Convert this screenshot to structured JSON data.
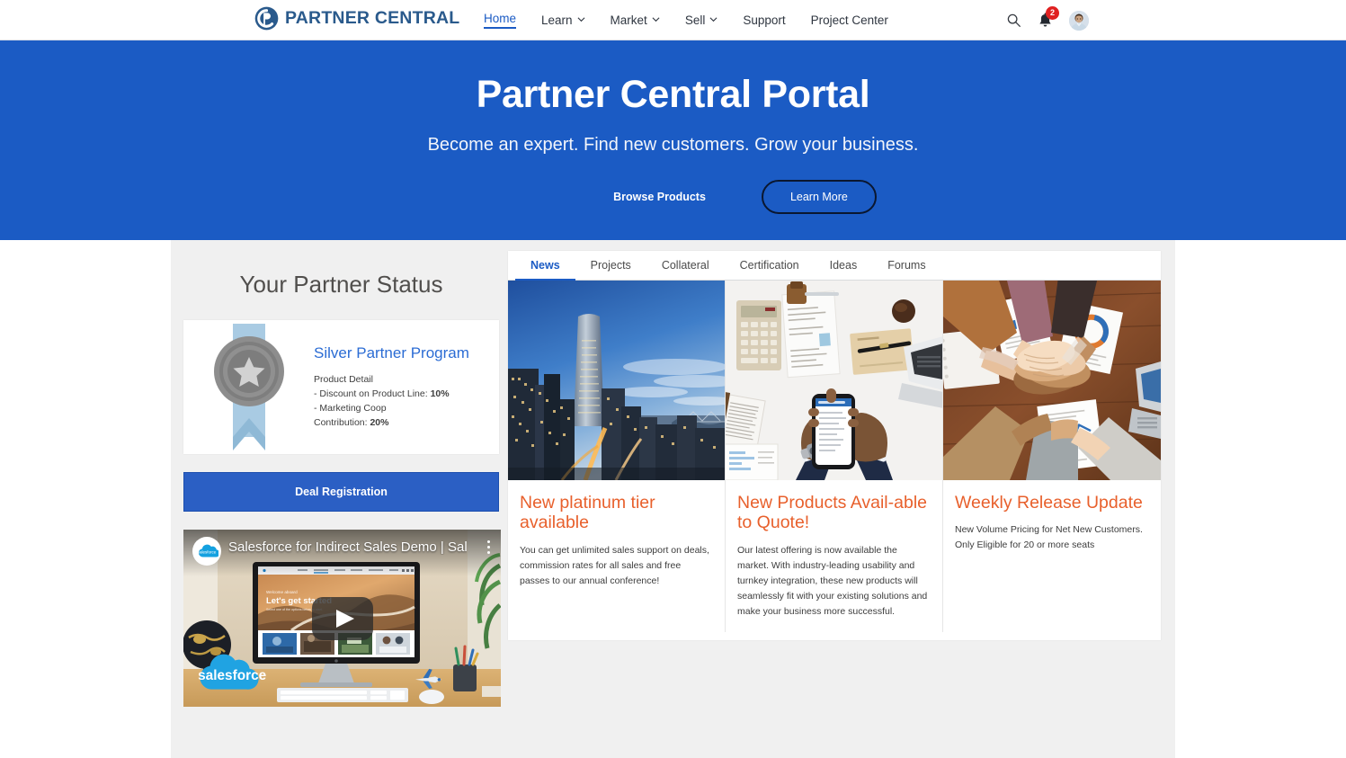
{
  "brand": {
    "name": "PARTNER CENTRAL",
    "logo_icon": "pc-monogram-icon",
    "logo_color": "#2a5a8c"
  },
  "nav": {
    "items": [
      {
        "label": "Home",
        "active": true,
        "has_caret": false
      },
      {
        "label": "Learn",
        "active": false,
        "has_caret": true
      },
      {
        "label": "Market",
        "active": false,
        "has_caret": true
      },
      {
        "label": "Sell",
        "active": false,
        "has_caret": true
      },
      {
        "label": "Support",
        "active": false,
        "has_caret": false
      },
      {
        "label": "Project Center",
        "active": false,
        "has_caret": false
      }
    ],
    "search_icon": "search-icon",
    "notifications_icon": "bell-icon",
    "notifications_count": "2",
    "avatar_icon": "user-avatar"
  },
  "hero": {
    "title": "Partner Central Portal",
    "subtitle": "Become an expert. Find new customers. Grow your business.",
    "browse_label": "Browse Products",
    "learn_more_label": "Learn More",
    "background_color": "#1b5bc4"
  },
  "status": {
    "heading": "Your Partner Status",
    "medal_icon": "silver-medal-ribbon-icon",
    "tier_title": "Silver Partner Program",
    "detail_heading": "Product Detail",
    "detail_line1_label": "- Discount on Product Line:",
    "detail_line1_value": "10%",
    "detail_line2_label": "- Marketing Coop",
    "detail_line3_label": "Contribution:",
    "detail_line3_value": "20%",
    "deal_button_label": "Deal Registration",
    "tier_color": "#2b6cd4"
  },
  "video": {
    "title": "Salesforce for Indirect Sales Demo | Sal...",
    "channel_icon": "salesforce-cloud-icon",
    "play_icon": "youtube-play-icon",
    "menu_icon": "kebab-menu-icon",
    "watermark": "salesforce",
    "screen_headline": "Let's get started",
    "screen_eyebrow": "Welcome aboard"
  },
  "feed": {
    "tabs": [
      {
        "label": "News",
        "active": true
      },
      {
        "label": "Projects",
        "active": false
      },
      {
        "label": "Collateral",
        "active": false
      },
      {
        "label": "Certification",
        "active": false
      },
      {
        "label": "Ideas",
        "active": false
      },
      {
        "label": "Forums",
        "active": false
      }
    ],
    "cards": [
      {
        "image_name": "city-skyline-dusk-image",
        "title": "New platinum tier available",
        "text": "You can get unlimited sales support on deals, commission rates for all sales and free passes to our annual conference!"
      },
      {
        "image_name": "desk-flatlay-phone-image",
        "title": "New Products Avail-able to Quote!",
        "text": "Our latest offering is now available the market. With industry-leading usability and turnkey integration, these new products will seamlessly fit with your existing solutions and make your business more successful."
      },
      {
        "image_name": "team-hands-stacked-image",
        "title": "Weekly Release Update",
        "text": "New Volume Pricing for Net New Customers. Only Eligible for 20 or more seats"
      }
    ],
    "title_color": "#e8602c"
  }
}
